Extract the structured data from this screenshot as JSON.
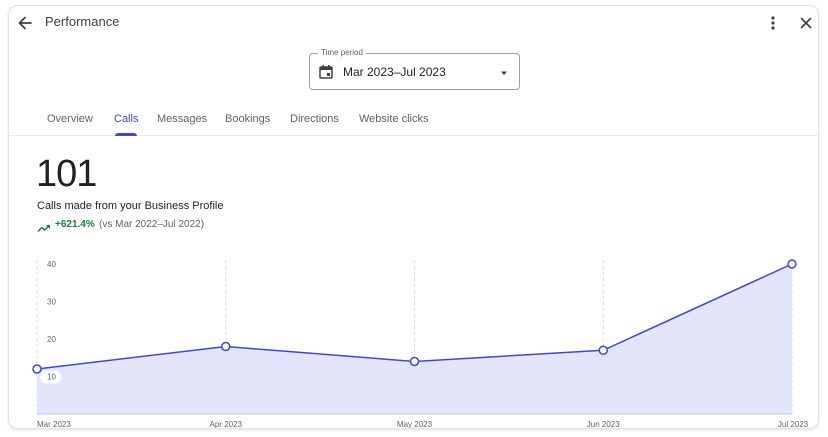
{
  "header": {
    "title": "Performance",
    "back_icon": "arrow-back-icon",
    "more_icon": "more-vert-icon",
    "close_icon": "close-icon"
  },
  "time_period": {
    "label": "Time period",
    "value": "Mar 2023–Jul 2023",
    "icon": "calendar-icon"
  },
  "tabs": [
    {
      "label": "Overview",
      "active": false
    },
    {
      "label": "Calls",
      "active": true
    },
    {
      "label": "Messages",
      "active": false
    },
    {
      "label": "Bookings",
      "active": false
    },
    {
      "label": "Directions",
      "active": false
    },
    {
      "label": "Website clicks",
      "active": false
    }
  ],
  "metric": {
    "value": "101",
    "label": "Calls made from your Business Profile",
    "change": "+621.4%",
    "comparison": "(vs Mar 2022–Jul 2022)"
  },
  "colors": {
    "accent": "#3c49d6",
    "area_fill": "#e3e6fb",
    "positive": "#188038"
  },
  "chart_data": {
    "type": "area",
    "x": [
      "Mar 2023",
      "Apr 2023",
      "May 2023",
      "Jun 2023",
      "Jul 2023"
    ],
    "values": [
      12,
      18,
      14,
      17,
      40
    ],
    "ylim": [
      0,
      40
    ],
    "yticks": [
      10,
      20,
      30,
      40
    ],
    "grid": "vertical-dashed"
  }
}
